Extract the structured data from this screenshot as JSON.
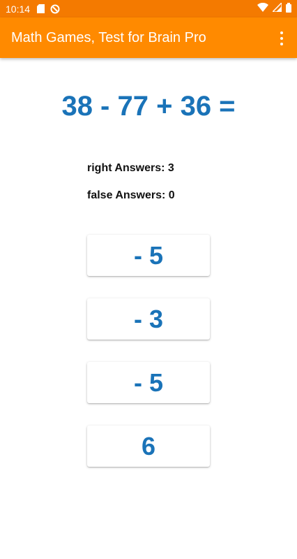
{
  "status_bar": {
    "time": "10:14",
    "icons": [
      "sd-card-icon",
      "vpn-icon",
      "wifi-icon",
      "signal-icon",
      "battery-icon"
    ]
  },
  "app_bar": {
    "title": "Math Games, Test for Brain Pro",
    "menu_icon": "overflow-menu-icon"
  },
  "quiz": {
    "equation": "38 - 77 + 36 =",
    "right_label": "right Answers: 3",
    "false_label": "false Answers: 0"
  },
  "answers": [
    {
      "label": "- 5"
    },
    {
      "label": "- 3"
    },
    {
      "label": "- 5"
    },
    {
      "label": "6"
    }
  ],
  "colors": {
    "status_bar": "#f47a00",
    "app_bar": "#ff8a00",
    "accent": "#1a73b8"
  }
}
